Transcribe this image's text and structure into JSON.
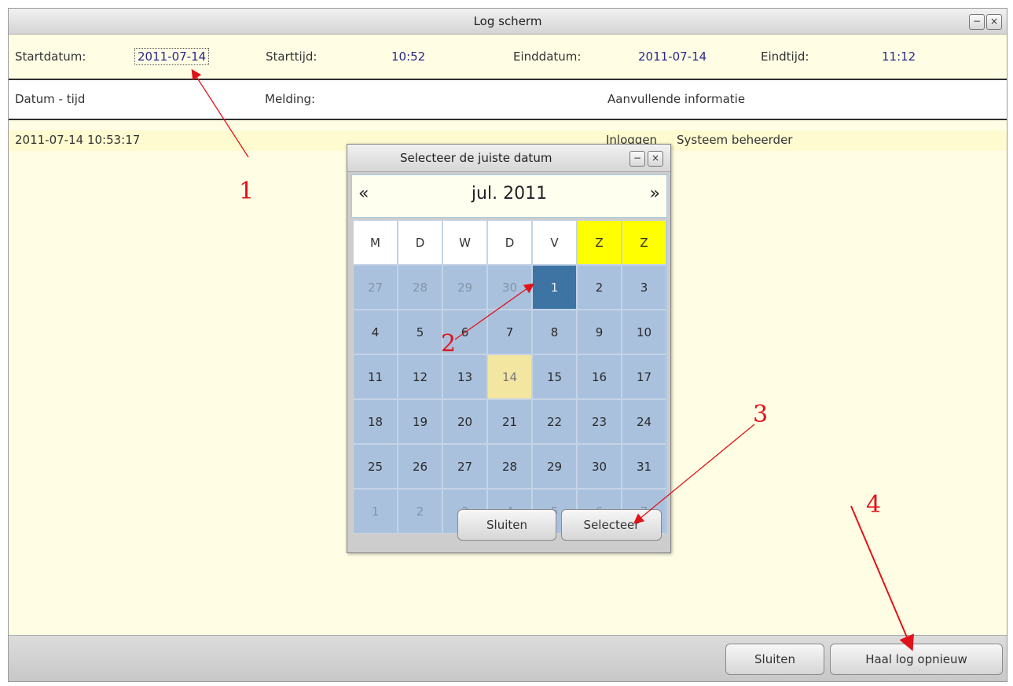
{
  "window": {
    "title": "Log scherm",
    "minimize_glyph": "−",
    "close_glyph": "×"
  },
  "filters": {
    "start_date_label": "Startdatum:",
    "start_date_value": "2011-07-14",
    "start_time_label": "Starttijd:",
    "start_time_value": "10:52",
    "end_date_label": "Einddatum:",
    "end_date_value": "2011-07-14",
    "end_time_label": "Eindtijd:",
    "end_time_value": "11:12"
  },
  "table": {
    "columns": [
      "Datum - tijd",
      "Melding:",
      "Aanvullende informatie"
    ],
    "rows": [
      {
        "datetime": "2011-07-14 10:53:17",
        "message": "Inloggen",
        "info": "Systeem beheerder"
      }
    ]
  },
  "footer": {
    "close_label": "Sluiten",
    "reload_label": "Haal log opnieuw"
  },
  "calendar_dialog": {
    "title": "Selecteer de juiste datum",
    "minimize_glyph": "−",
    "close_glyph": "×",
    "prev_glyph": "«",
    "next_glyph": "»",
    "month_label": "jul. 2011",
    "weekdays": [
      "M",
      "D",
      "W",
      "D",
      "V",
      "Z",
      "Z"
    ],
    "weekend_highlight_color": "#ffff00",
    "selected_color": "#3e74a4",
    "today_color": "#f3e6a0",
    "days": [
      {
        "d": "27",
        "other": true
      },
      {
        "d": "28",
        "other": true
      },
      {
        "d": "29",
        "other": true
      },
      {
        "d": "30",
        "other": true
      },
      {
        "d": "1",
        "selected": true
      },
      {
        "d": "2"
      },
      {
        "d": "3"
      },
      {
        "d": "4"
      },
      {
        "d": "5"
      },
      {
        "d": "6"
      },
      {
        "d": "7"
      },
      {
        "d": "8"
      },
      {
        "d": "9"
      },
      {
        "d": "10"
      },
      {
        "d": "11"
      },
      {
        "d": "12"
      },
      {
        "d": "13"
      },
      {
        "d": "14",
        "today": true
      },
      {
        "d": "15"
      },
      {
        "d": "16"
      },
      {
        "d": "17"
      },
      {
        "d": "18"
      },
      {
        "d": "19"
      },
      {
        "d": "20"
      },
      {
        "d": "21"
      },
      {
        "d": "22"
      },
      {
        "d": "23"
      },
      {
        "d": "24"
      },
      {
        "d": "25"
      },
      {
        "d": "26"
      },
      {
        "d": "27"
      },
      {
        "d": "28"
      },
      {
        "d": "29"
      },
      {
        "d": "30"
      },
      {
        "d": "31"
      },
      {
        "d": "1",
        "other": true
      },
      {
        "d": "2",
        "other": true
      },
      {
        "d": "3",
        "other": true
      },
      {
        "d": "4",
        "other": true
      },
      {
        "d": "5",
        "other": true
      },
      {
        "d": "6",
        "other": true
      },
      {
        "d": "7",
        "other": true
      }
    ],
    "close_label": "Sluiten",
    "select_label": "Selecteer"
  },
  "annotations": {
    "n1": "1",
    "n2": "2",
    "n3": "3",
    "n4": "4",
    "color": "#e0131a"
  }
}
